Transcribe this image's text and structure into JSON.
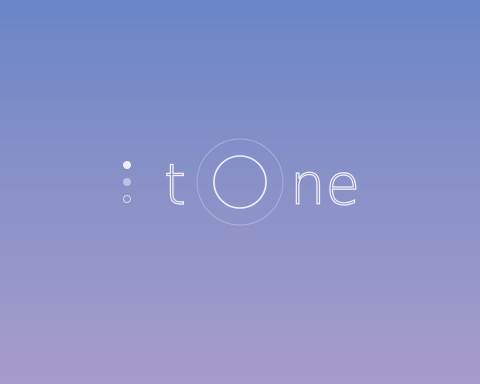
{
  "logo": {
    "text": "tone",
    "letter_t": "t",
    "letter_o": "o",
    "letters_ne": "ne"
  },
  "page_indicator": {
    "count": 3,
    "active_index": 0
  },
  "colors": {
    "background_top": "#6a86c6",
    "background_bottom": "#a79ccb",
    "foreground": "#f3f0fb"
  }
}
